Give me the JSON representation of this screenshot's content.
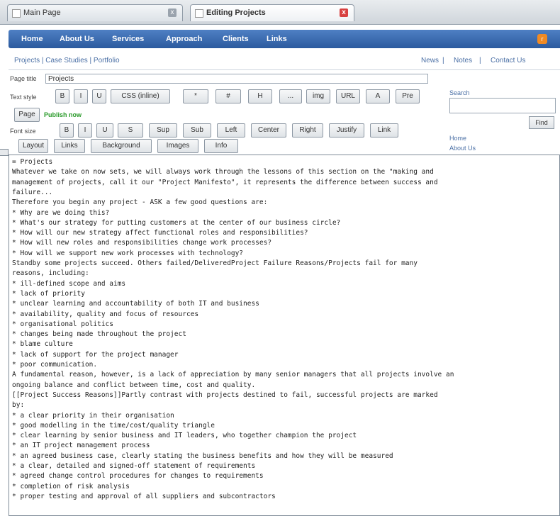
{
  "browser": {
    "tabs": [
      {
        "label": "Main Page"
      },
      {
        "label": "Editing Projects"
      }
    ],
    "close_glyph": "x"
  },
  "nav": {
    "links": [
      "Home",
      "About Us",
      "Services",
      "Approach",
      "Clients",
      "Links"
    ],
    "rss_glyph": "r"
  },
  "crumbs": {
    "left": "Projects | Case Studies | Portfolio",
    "right": [
      "News",
      "Notes",
      "Contact Us"
    ],
    "separator": "|"
  },
  "form": {
    "page_title_label": "Page title",
    "page_title_value": "Projects",
    "format_label": "Text style",
    "format_buttons": [
      "B",
      "I",
      "U",
      "CSS (inline)",
      "*",
      "#",
      "H",
      "...",
      "img",
      "URL",
      "A",
      "Pre"
    ],
    "page_button": "Page",
    "publish_label": "Publish now",
    "font_label": "Font size",
    "font_buttons": [
      "B",
      "I",
      "U",
      "S",
      "Sup",
      "Sub",
      "Left",
      "Center",
      "Right",
      "Justify",
      "Link"
    ],
    "section_tabs": [
      "Layout",
      "Links",
      "Background",
      "Images",
      "Info"
    ]
  },
  "sidebar": {
    "search_label": "Search",
    "search_button": "Find",
    "links": [
      "Home",
      "About Us"
    ]
  },
  "editor": {
    "lines": [
      "= Projects",
      "Whatever we take on now sets, we will always work through the lessons of this section on the \"making and",
      "management of projects, call it our \"Project Manifesto\", it represents the difference between success and",
      "failure...",
      "Therefore you begin any project - ASK a few good questions are:",
      "* Why are we doing this?",
      "* What's our strategy for putting customers at the center of our business circle?",
      "* How will our new strategy affect functional roles and responsibilities?",
      "* How will new roles and responsibilities change work processes?",
      "* How will we support new work processes with technology?",
      "Standby some projects succeed. Others failed/DeliveredProject Failure Reasons/Projects fail for many",
      "reasons, including:",
      "* ill-defined scope and aims",
      "* lack of priority",
      "* unclear learning and accountability of both IT and business",
      "* availability, quality and focus of resources",
      "* organisational politics",
      "* changes being made throughout the project",
      "* blame culture",
      "* lack of support for the project manager",
      "* poor communication.",
      "A fundamental reason, however, is a lack of appreciation by many senior managers that all projects involve an",
      "ongoing balance and conflict between time, cost and quality.",
      "[[Project Success Reasons]]Partly contrast with projects destined to fail, successful projects are marked",
      "by:",
      "* a clear priority in their organisation",
      "* good modelling in the time/cost/quality triangle",
      "* clear learning by senior business and IT leaders, who together champion the project",
      "* an IT project management process",
      "* an agreed business case, clearly stating the business benefits and how they will be measured",
      "* a clear, detailed and signed-off statement of requirements",
      "* agreed change control procedures for changes to requirements",
      "* completion of risk analysis",
      "* proper testing and approval of all suppliers and subcontractors"
    ]
  }
}
